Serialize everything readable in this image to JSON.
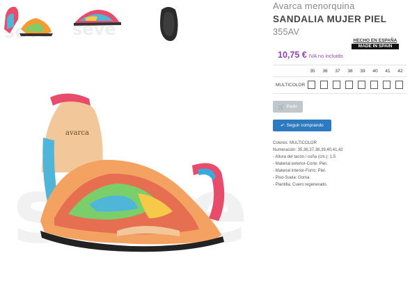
{
  "product": {
    "subtitle": "Avarca menorquina",
    "title": "SANDALIA MUJER PIEL",
    "reference": "355AV",
    "price": "10,75 €",
    "vat_note": "IVA no incluido",
    "origin_badge": {
      "line1": "HECHO EN ESPAÑA",
      "line2": "MADE IN SPAIN"
    }
  },
  "size_grid": {
    "sizes": [
      "35",
      "36",
      "37",
      "38",
      "39",
      "40",
      "41",
      "42"
    ],
    "color_label": "MULTICOLOR"
  },
  "buttons": {
    "order_label": "Pedir",
    "continue_label": "Seguir comprando"
  },
  "description": [
    "Colores: MULTICOLOR",
    "Numeración: 35,36,37,38,39,40,41,42",
    "- Altura del tacón / cuña (cm.): 1.5",
    "- Material exterior-Corte: Piel.",
    "- Material interior-Forro: Piel.",
    "- Piso-Suela: Goma.",
    "- Plantilla: Cuero regenerado."
  ],
  "colors": {
    "price_purple": "#8e44ad",
    "button_blue": "#2d7ac0",
    "button_grey": "#c2c7cc"
  }
}
